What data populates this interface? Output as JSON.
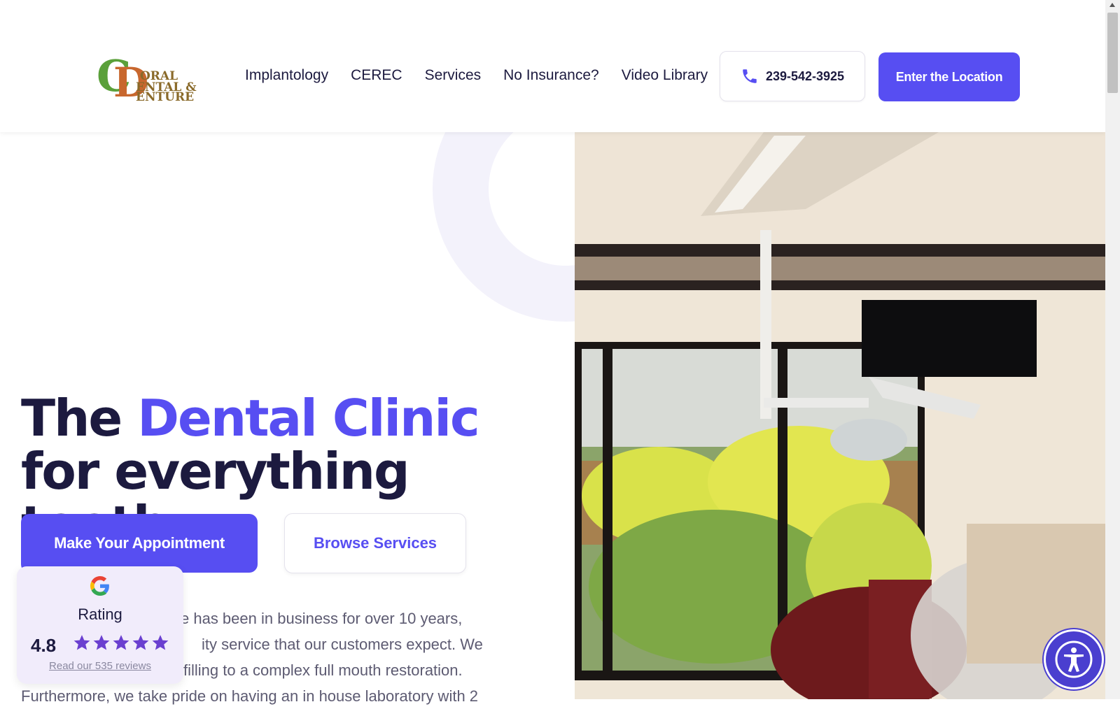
{
  "header": {
    "logo_text": "Oral Dental & Denture",
    "nav": [
      "Implantology",
      "CEREC",
      "Services",
      "No Insurance?",
      "Video Library"
    ],
    "phone": "239-542-3925",
    "cta": "Enter the Location"
  },
  "hero": {
    "headline_part1": "The ",
    "headline_accent": "Dental Clinic",
    "headline_part2": " for everything tooth.",
    "primary_button": "Make Your Appointment",
    "secondary_button": "Browse Services",
    "intro_line1": "e has been in business for over 10 years,",
    "intro_line2": "ity service that our customers expect. We",
    "intro_line3": "filling to a complex full mouth restoration.",
    "intro_line4": "Furthermore, we take pride on having an in house laboratory with 2"
  },
  "rating": {
    "label": "Rating",
    "score": "4.8",
    "stars": 5,
    "reviews_link": "Read our 535 reviews"
  },
  "colors": {
    "accent": "#574ef2",
    "ink": "#1c1a3f",
    "muted": "#5d5b72"
  }
}
